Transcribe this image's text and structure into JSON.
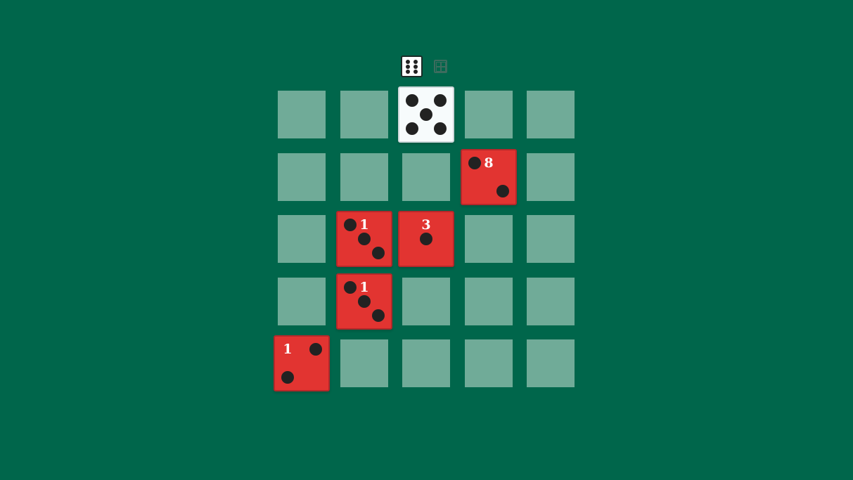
{
  "toolbar": {
    "icons": [
      {
        "name": "six-dice-icon",
        "pips": 6,
        "style": "outline-white"
      },
      {
        "name": "board-grid-icon",
        "style": "dim"
      }
    ]
  },
  "board": {
    "rows": 5,
    "cols": 5,
    "dice": [
      {
        "row": 0,
        "col": 2,
        "face": 5,
        "color": "white",
        "label": ""
      },
      {
        "row": 1,
        "col": 3,
        "face": 2,
        "color": "red",
        "label": "8"
      },
      {
        "row": 2,
        "col": 1,
        "face": 3,
        "color": "red",
        "label": "1"
      },
      {
        "row": 2,
        "col": 2,
        "face": 1,
        "color": "red",
        "label": "3"
      },
      {
        "row": 3,
        "col": 1,
        "face": 3,
        "color": "red",
        "label": "1"
      },
      {
        "row": 4,
        "col": 0,
        "face": 2,
        "color": "red",
        "label": "1",
        "mirrored": true
      }
    ]
  },
  "colors": {
    "background": "#00664b",
    "empty_slot": "#70ab98",
    "red_die": "#e23431",
    "white_die": "#f7fbfc",
    "pip": "#222222",
    "label": "#ffffff"
  }
}
